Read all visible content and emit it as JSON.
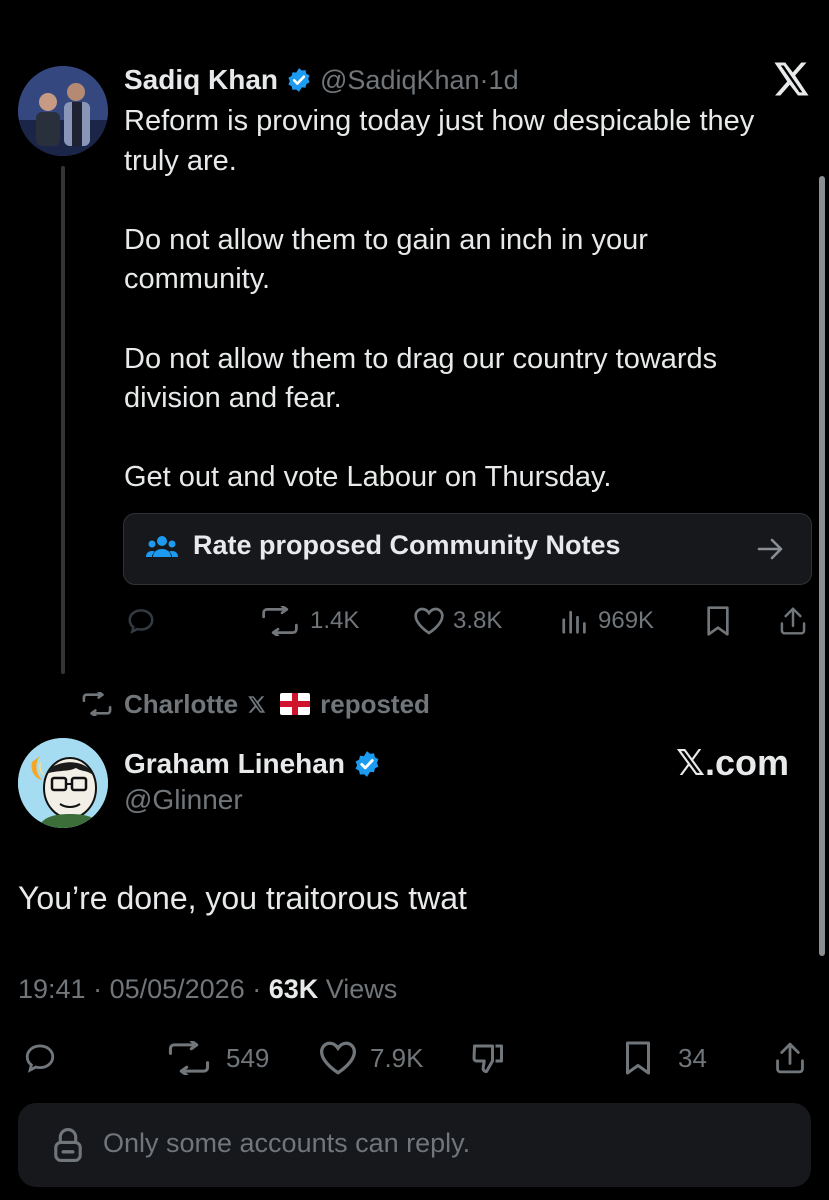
{
  "quoted_tweet": {
    "author_name": "Sadiq Khan",
    "handle": "@SadiqKhan",
    "time_sep": " · ",
    "time": "1d",
    "text": "Reform is proving today just how despicable they\ntruly are.\n\nDo not allow them to gain an inch in your\ncommunity.\n\nDo not allow them to drag our country towards\ndivision and fear.\n\nGet out and vote Labour on Thursday.",
    "community_notes_label": "Rate proposed Community Notes",
    "actions": {
      "reposts": "1.4K",
      "likes": "3.8K",
      "views": "969K"
    }
  },
  "repost_indicator": {
    "user": "Charlotte",
    "action": "reposted"
  },
  "main_tweet": {
    "author_name": "Graham Linehan",
    "handle": "@Glinner",
    "source_logo": "𝕏.com",
    "text": "You’re done, you traitorous twat",
    "time": "19:41",
    "date": "05/05/2026",
    "sep": " · ",
    "views_count": "63K",
    "views_label": " Views",
    "actions": {
      "reposts": "549",
      "likes": "7.9K",
      "bookmarks": "34"
    }
  },
  "reply_restriction": "Only some accounts can reply.",
  "colors": {
    "background": "#000000",
    "text": "#e7e9ea",
    "secondary": "#71767b",
    "verified": "#1d9bf0",
    "card": "#16181c"
  }
}
